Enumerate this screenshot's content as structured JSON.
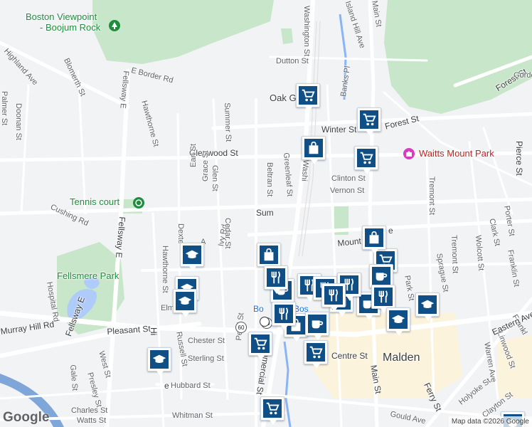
{
  "map": {
    "attribution": "Map data ©2026 Google",
    "logo": "Google",
    "colors": {
      "road": "#ffffff",
      "background": "#f1f3f4",
      "park": "#c8e6c9",
      "water": "#aecbfa",
      "commercial": "#fbf3dc",
      "marker": "#0f4f86"
    },
    "places": {
      "boston_viewpoint": "Boston Viewpoint",
      "boojum_rock": "- Boojum Rock",
      "tennis_court": "Tennis court",
      "fellsmere_park": "Fellsmere Park",
      "waitts_mount_park": "Waitts Mount Park",
      "oak_grove": "Oak G",
      "boston_partial_1": "Bo",
      "boston_partial_2": "Bos",
      "malden": "Malden",
      "ter_partial": "ter"
    },
    "streets": {
      "highland_ave": "Highland Ave",
      "blomerth_st": "Blomerth St",
      "e_border_rd": "E Border Rd",
      "border_rd": "Border Rd",
      "dutton_st": "Dutton St",
      "washington_st_top": "Washington St",
      "main_st_top": "Main St",
      "island_hill_ave": "Island Hill Ave",
      "palmer_st": "Palmer St",
      "doonan_st": "Doonan St",
      "fellsway_e_top": "Fellsway E",
      "hawthorne_st_top": "Hawthorne St",
      "summer_st_top": "Summer St",
      "banks_pl": "Banks Pl",
      "winter_st": "Winter St",
      "forest_st": "Forest St",
      "forest_st_2": "Forest St",
      "glenwood_st": "Glenwood St",
      "beltran_st": "Beltran St",
      "greenleaf_st": "Greenleaf St",
      "washington_partial": "Washi",
      "clinton_st": "Clinton St",
      "vernon_st": "Vernon St",
      "pierce_st": "Pierce St",
      "earl_st": "Earl St",
      "grace_st": "Grace St",
      "glen_st": "Glen St",
      "cushing_rd": "Cushing Rd",
      "tremont_st_top": "Tremont St",
      "porter_st": "Porter St",
      "clark_st": "Clark St",
      "summer_partial": "Sum",
      "dexter_partial": "Dexte",
      "ivy_rd": "Ivy Rd",
      "cedar_st": "Cedar St",
      "a_partial": "A",
      "mount_vernon_partial": "Mount",
      "mount_vernon_partial_2": "e",
      "hawthorne_st_mid": "Hawthorne St",
      "wolcott_st": "Wolcott St",
      "franklin_st": "Franklin St",
      "tremont_st_mid": "Tremont St",
      "sprague_st": "Sprague St",
      "park_st": "Park St",
      "hospital_rd": "Hospital Rd",
      "fellsway_e_mid": "Fellsway E",
      "fellsway_e_low": "Fellsway E",
      "elm_partial": "Elm",
      "murray_hill_rd": "Murray Hill Rd",
      "pleasant_st": "Pleasant St",
      "chester_st": "Chester St",
      "sterling_st": "Sterling St",
      "centre_st": "Centre St",
      "main_st_bottom": "Main St",
      "commercial_st": "Commercial St",
      "pearl_st": "Pearl St",
      "russell_st": "Russell St",
      "h_partial": "Hi",
      "e_partial": "e",
      "gale_st": "Gale St",
      "presley_st": "Presley St",
      "west_st": "West St",
      "hubbard_st": "Hubbard St",
      "charles_st": "Charles St",
      "watts_st": "Watts St",
      "whitman_st": "Whitman St",
      "gould_ave": "Gould Ave",
      "ferry_st": "Ferry St",
      "holyoke_st": "Holyoke St",
      "clayton_st": "Clayton St",
      "warren_ave": "Warren Ave",
      "linwood_st": "Linwood St",
      "frankl_partial": "Frankl",
      "eastern_ave": "Eastern Ave",
      "gordon_partial": "Gordo"
    },
    "routes": {
      "r60a": "60",
      "r60b": "60"
    }
  }
}
